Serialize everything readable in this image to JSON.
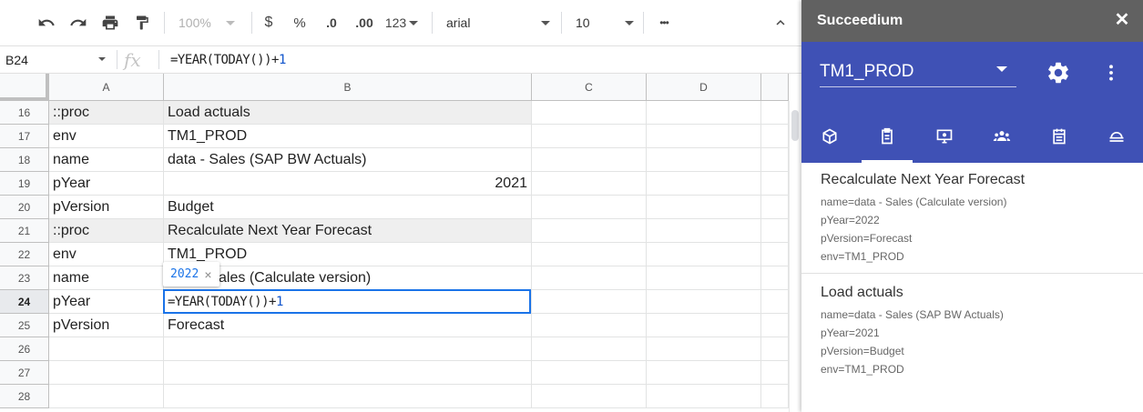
{
  "toolbar": {
    "zoom": "100%",
    "currency": "$",
    "percent": "%",
    "decrease_decimals": ".0",
    "increase_decimals": ".00",
    "number_format": "123",
    "font": "arial",
    "font_size": "10",
    "more": "•••"
  },
  "formula_bar": {
    "cell_ref": "B24",
    "fx_label": "fx",
    "formula_prefix": "=YEAR(TODAY())+",
    "formula_num": "1"
  },
  "grid": {
    "columns": [
      "A",
      "B",
      "C",
      "D"
    ],
    "rows": [
      {
        "num": "16",
        "a": "::proc",
        "b": "Load actuals",
        "shaded": true
      },
      {
        "num": "17",
        "a": "env",
        "b": "TM1_PROD"
      },
      {
        "num": "18",
        "a": "name",
        "b": "data - Sales (SAP BW Actuals)"
      },
      {
        "num": "19",
        "a": "pYear",
        "b": "2021",
        "right": true
      },
      {
        "num": "20",
        "a": "pVersion",
        "b": "Budget"
      },
      {
        "num": "21",
        "a": "::proc",
        "b": "Recalculate Next Year Forecast",
        "shaded": true
      },
      {
        "num": "22",
        "a": "env",
        "b": "TM1_PROD"
      },
      {
        "num": "23",
        "a": "name",
        "b": "data - Sales (Calculate version)"
      },
      {
        "num": "24",
        "a": "pYear",
        "b": "",
        "selected": true
      },
      {
        "num": "25",
        "a": "pVersion",
        "b": "Forecast"
      },
      {
        "num": "26",
        "a": "",
        "b": ""
      },
      {
        "num": "27",
        "a": "",
        "b": ""
      },
      {
        "num": "28",
        "a": "",
        "b": ""
      }
    ],
    "active_cell": {
      "prefix": "=YEAR(TODAY())+",
      "num": "1"
    },
    "tooltip": {
      "value": "2022",
      "close": "×"
    }
  },
  "panel": {
    "title": "Succeedium",
    "close": "✕",
    "environment": "TM1_PROD",
    "tabs": [
      "cube-icon",
      "clipboard-icon",
      "monitor-icon",
      "users-icon",
      "calendar-icon",
      "cloud-icon"
    ],
    "active_tab": 1,
    "cards": [
      {
        "title": "Recalculate Next Year Forecast",
        "lines": [
          "name=data - Sales (Calculate version)",
          "pYear=2022",
          "pVersion=Forecast",
          "env=TM1_PROD"
        ]
      },
      {
        "title": "Load actuals",
        "lines": [
          "name=data - Sales (SAP BW Actuals)",
          "pYear=2021",
          "pVersion=Budget",
          "env=TM1_PROD"
        ]
      }
    ]
  }
}
